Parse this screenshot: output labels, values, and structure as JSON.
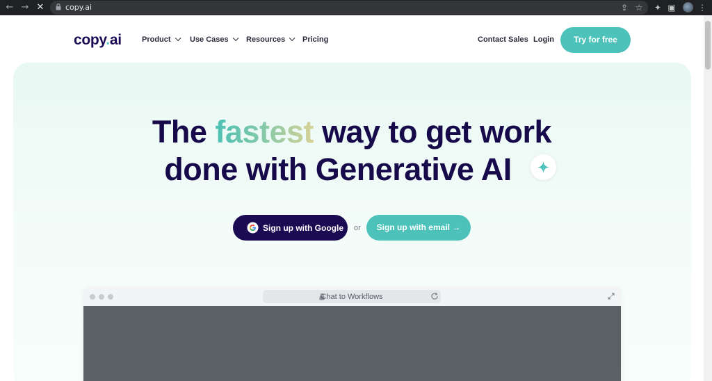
{
  "browser": {
    "url": "copy.ai",
    "icons": [
      "back-arrow-icon",
      "forward-arrow-icon",
      "stop-loading-icon",
      "lock-icon",
      "share-icon",
      "star-icon",
      "extensions-icon",
      "side-panel-icon",
      "profile-avatar",
      "more-menu-icon"
    ]
  },
  "header": {
    "logo": {
      "part1": "copy",
      "dot": ".",
      "part2": "ai"
    },
    "nav": [
      {
        "label": "Product",
        "has_dropdown": true
      },
      {
        "label": "Use Cases",
        "has_dropdown": true
      },
      {
        "label": "Resources",
        "has_dropdown": true
      },
      {
        "label": "Pricing",
        "has_dropdown": false
      }
    ],
    "contact_sales": "Contact Sales",
    "login": "Login",
    "cta": "Try for free"
  },
  "hero": {
    "headline_line1_pre": "The ",
    "headline_accent": "fastest",
    "headline_line1_post": " way to get work",
    "headline_line2": "done with Generative AI",
    "google_button": "Sign up with Google",
    "or": "or",
    "email_button": "Sign up with email →"
  },
  "preview": {
    "address_text": "Chat to Workflows"
  },
  "colors": {
    "brand_dark": "#1a0b52",
    "brand_teal": "#4dc2bb",
    "hero_bg": "#e9f8f3"
  }
}
